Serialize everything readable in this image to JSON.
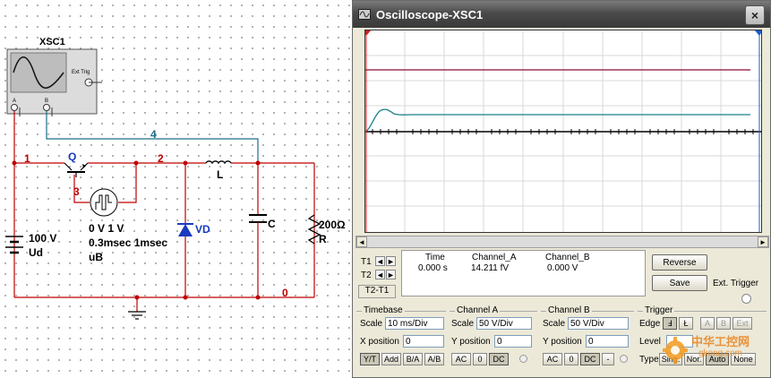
{
  "schematic": {
    "scope_ref": "XSC1",
    "scope_ext_trig": "Ext Trig",
    "scope_port_a": "A",
    "scope_port_b": "B",
    "net_1": "1",
    "net_2": "2",
    "net_3": "3",
    "net_4": "4",
    "net_0": "0",
    "transistor_label": "Q",
    "pulse_source_value": "0 V 1 V",
    "pulse_source_timing": "0.3msec 1msec",
    "pulse_source_ref": "uB",
    "dc_source_value": "100 V",
    "dc_source_ref": "Ud",
    "diode_ref": "VD",
    "inductor_ref": "L",
    "capacitor_ref": "C",
    "resistor_value": "200Ω",
    "resistor_ref": "R"
  },
  "window": {
    "title": "Oscilloscope-XSC1",
    "close": "×"
  },
  "cursors": {
    "t1_label": "T1",
    "t2_label": "T2",
    "t2t1_label": "T2-T1",
    "left_arrow": "◄",
    "right_arrow": "►"
  },
  "readout": {
    "headers": [
      "Time",
      "Channel_A",
      "Channel_B"
    ],
    "row": [
      "0.000 s",
      "14.211 fV",
      "0.000 V"
    ]
  },
  "buttons": {
    "reverse": "Reverse",
    "save": "Save",
    "ext_trigger": "Ext. Trigger"
  },
  "timebase": {
    "title": "Timebase",
    "scale_label": "Scale",
    "scale_value": "10 ms/Div",
    "xpos_label": "X position",
    "xpos_value": "0",
    "modes": [
      "Y/T",
      "Add",
      "B/A",
      "A/B"
    ],
    "active_mode": "Y/T"
  },
  "channel_a": {
    "title": "Channel A",
    "scale_label": "Scale",
    "scale_value": "50  V/Div",
    "ypos_label": "Y position",
    "ypos_value": "0",
    "coupling": [
      "AC",
      "0",
      "DC"
    ]
  },
  "channel_b": {
    "title": "Channel B",
    "scale_label": "Scale",
    "scale_value": "50  V/Div",
    "ypos_label": "Y position",
    "ypos_value": "0",
    "coupling": [
      "AC",
      "0",
      "DC",
      "-"
    ]
  },
  "trigger": {
    "title": "Trigger",
    "edge_label": "Edge",
    "edge_buttons": [
      "Ⅎ",
      "Ł",
      "A",
      "B",
      "Ext"
    ],
    "level_label": "Level",
    "type_label": "Type",
    "type_buttons": [
      "Sing.",
      "Nor.",
      "Auto",
      "None"
    ]
  },
  "watermark": {
    "text_cn": "中华工控网",
    "text_url": "gkong.com"
  },
  "colors": {
    "wire_red": "#c00000",
    "wire_blue": "#1a6f8a",
    "trace_a": "#8b0a3c",
    "trace_b": "#1a7f8a",
    "cursor_t1": "#d02020",
    "cursor_t2": "#1a5fd0",
    "diode_blue": "#1a3bbf"
  }
}
